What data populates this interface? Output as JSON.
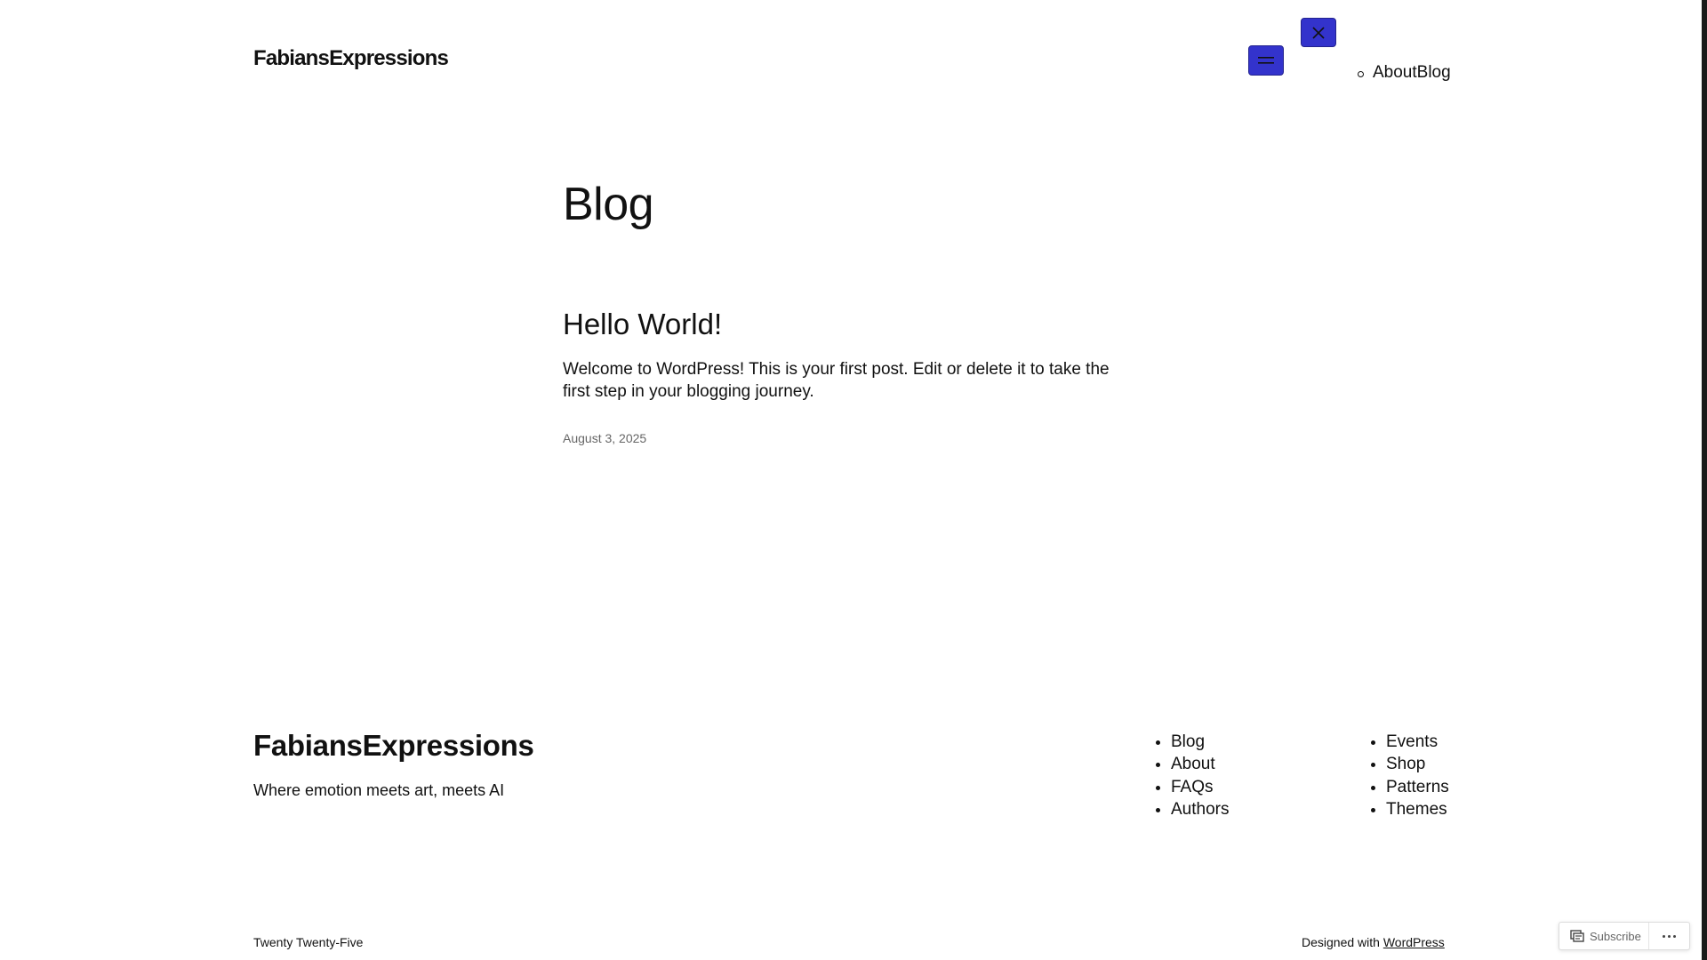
{
  "header": {
    "site_title": "FabiansExpressions",
    "menu_open_icon": "hamburger-icon",
    "menu_close_icon": "close-icon",
    "nav_items": [
      "About",
      "Blog"
    ]
  },
  "main": {
    "page_heading": "Blog",
    "post": {
      "title": "Hello World!",
      "excerpt": "Welcome to WordPress! This is your first post. Edit or delete it to take the first step in your blogging journey.",
      "date": "August 3, 2025"
    }
  },
  "footer": {
    "site_title": "FabiansExpressions",
    "tagline": "Where emotion meets art, meets AI",
    "nav_col_1": [
      "Blog",
      "About",
      "FAQs",
      "Authors"
    ],
    "nav_col_2": [
      "Events",
      "Shop",
      "Patterns",
      "Themes"
    ],
    "credit_left": "Twenty Twenty-Five",
    "credit_right_prefix": "Designed with ",
    "credit_right_link": "WordPress"
  },
  "subscribe_widget": {
    "subscribe_label": "Subscribe",
    "subscribe_icon": "reader-icon",
    "more_icon": "ellipsis-icon"
  },
  "colors": {
    "accent": "#3333cc",
    "text": "#111111",
    "muted": "#666666"
  }
}
